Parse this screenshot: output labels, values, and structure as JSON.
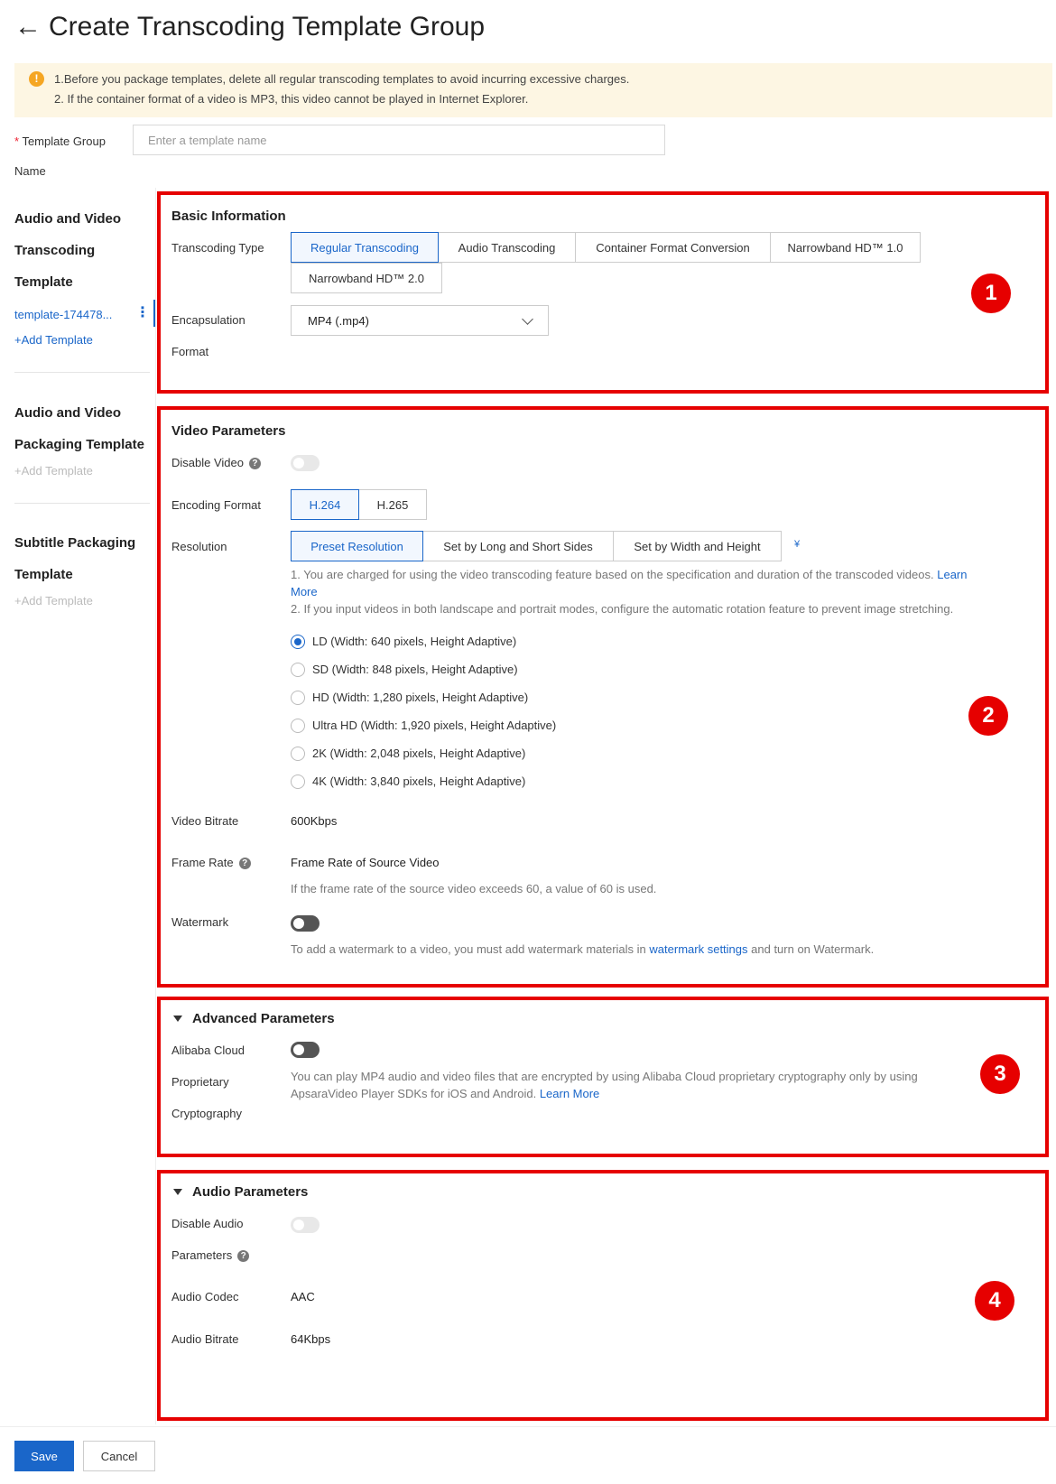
{
  "header": {
    "back_icon": "arrow-left-icon",
    "title": "Create Transcoding Template Group"
  },
  "banner": {
    "icon": "warning-icon",
    "line1": "1.Before you package templates, delete all regular transcoding templates to avoid incurring excessive charges.",
    "line2": "2. If the container format of a video is MP3, this video cannot be played in Internet Explorer."
  },
  "template_group": {
    "required_mark": "*",
    "label_line1": "Template Group",
    "label_line2": "Name",
    "placeholder": "Enter a template name",
    "value": ""
  },
  "nav": {
    "transcoding": {
      "line1": "Audio and Video",
      "line2": "Transcoding",
      "line3": "Template",
      "active_item": "template-174478...",
      "add": "+Add Template"
    },
    "packaging": {
      "line1": "Audio and Video",
      "line2": "Packaging Template",
      "add": "+Add Template"
    },
    "subtitle": {
      "line1": "Subtitle Packaging",
      "line2": "Template",
      "add": "+Add Template"
    }
  },
  "badges": [
    "1",
    "2",
    "3",
    "4"
  ],
  "basic": {
    "title": "Basic Information",
    "transcoding_type_label": "Transcoding Type",
    "types": [
      "Regular Transcoding",
      "Audio Transcoding",
      "Container Format Conversion",
      "Narrowband HD™ 1.0",
      "Narrowband HD™ 2.0"
    ],
    "selected_type": "Regular Transcoding",
    "encapsulation_label1": "Encapsulation",
    "encapsulation_label2": "Format",
    "encapsulation_value": "MP4 (.mp4)"
  },
  "video": {
    "title": "Video Parameters",
    "disable_video_label": "Disable Video",
    "disable_video_on": false,
    "encoding_label": "Encoding Format",
    "encodings": [
      "H.264",
      "H.265"
    ],
    "selected_encoding": "H.264",
    "resolution_label": "Resolution",
    "resolution_modes": [
      "Preset Resolution",
      "Set by Long and Short Sides",
      "Set by Width and Height"
    ],
    "selected_mode": "Preset Resolution",
    "price_icon": "¥",
    "note1a": "1. You are charged for using the video transcoding feature based on the specification and duration of the transcoded videos.",
    "note1_link1": "Learn",
    "note1_link2": "More",
    "note2": "2. If you input videos in both landscape and portrait modes, configure the automatic rotation feature to prevent image stretching.",
    "resolutions": [
      "LD (Width: 640 pixels, Height Adaptive)",
      "SD (Width: 848 pixels, Height Adaptive)",
      "HD (Width: 1,280 pixels, Height Adaptive)",
      "Ultra HD (Width: 1,920 pixels, Height Adaptive)",
      "2K (Width: 2,048 pixels, Height Adaptive)",
      "4K (Width: 3,840 pixels, Height Adaptive)"
    ],
    "selected_resolution": "LD (Width: 640 pixels, Height Adaptive)",
    "bitrate_label": "Video Bitrate",
    "bitrate_value": "600Kbps",
    "framerate_label": "Frame Rate",
    "framerate_value": "Frame Rate of Source Video",
    "framerate_hint": "If the frame rate of the source video exceeds 60, a value of 60 is used.",
    "watermark_label": "Watermark",
    "watermark_on": false,
    "watermark_hint_pre": "To add a watermark to a video, you must add watermark materials in",
    "watermark_link": "watermark settings",
    "watermark_hint_post": "and turn on Watermark."
  },
  "advanced": {
    "title": "Advanced Parameters",
    "crypto_label1": "Alibaba Cloud",
    "crypto_label2": "Proprietary",
    "crypto_label3": "Cryptography",
    "crypto_on": false,
    "hint_line1": "You can play MP4 audio and video files that are encrypted by using Alibaba Cloud proprietary cryptography only by using",
    "hint_line2": "ApsaraVideo Player SDKs for iOS and Android.",
    "hint_link": "Learn More"
  },
  "audio": {
    "title": "Audio Parameters",
    "disable_label1": "Disable Audio",
    "disable_label2": "Parameters",
    "disable_on": false,
    "codec_label": "Audio Codec",
    "codec_value": "AAC",
    "bitrate_label": "Audio Bitrate",
    "bitrate_value": "64Kbps"
  },
  "footer": {
    "save": "Save",
    "cancel": "Cancel"
  }
}
